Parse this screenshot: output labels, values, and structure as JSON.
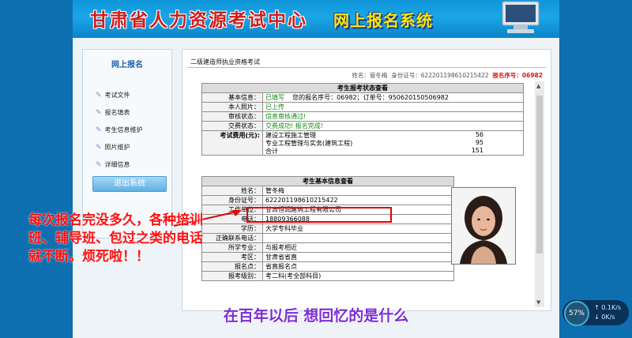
{
  "banner": {
    "title": "甘肃省人力资源考试中心",
    "system": "网上报名系统"
  },
  "sidebar": {
    "title": "网上报名",
    "items": [
      {
        "label": "考试文件"
      },
      {
        "label": "报名填表"
      },
      {
        "label": "考生信息维护"
      },
      {
        "label": "照片维护"
      },
      {
        "label": "详细信息"
      }
    ],
    "logout": "退出系统"
  },
  "exam": {
    "name": "二级建造师执业资格考试"
  },
  "candidate_line": {
    "name_label": "姓名：",
    "name": "管冬梅",
    "id_label": "身份证号：",
    "id": "622201198610215422",
    "reg_label": "报名序号：",
    "reg": "06982"
  },
  "status_section": {
    "title": "考生报考状态查看",
    "rows": [
      {
        "label": "基本信息：",
        "status": "已填写",
        "note": "您的报名序号：06982；订单号：950620150506982"
      },
      {
        "label": "本人照片：",
        "status": "已上传"
      },
      {
        "label": "审核状态：",
        "status": "信息审核通过!"
      },
      {
        "label": "交费状态：",
        "status": "交费成功! 报名完成!"
      }
    ],
    "fee_label": "考试费用(元):",
    "fees": [
      {
        "item": "建设工程施工管理",
        "amount": "56"
      },
      {
        "item": "专业工程管理与实务(建筑工程)",
        "amount": "95"
      },
      {
        "item": "合计",
        "amount": "151"
      }
    ]
  },
  "basic_section": {
    "title": "考生基本信息查看",
    "rows": [
      {
        "label": "姓名：",
        "value": "管冬梅"
      },
      {
        "label": "身份证号：",
        "value": "622201198610215422"
      },
      {
        "label": "工作单位：",
        "value": "甘肃恒润建筑工程有限公司"
      },
      {
        "label": "电话：",
        "value": "18809366088"
      },
      {
        "label": "学历：",
        "value": "大学专科毕业"
      },
      {
        "label": "正确联系电话：",
        "value": ""
      },
      {
        "label": "所学专业：",
        "value": "与报考相近"
      },
      {
        "label": "考区：",
        "value": "甘肃省省直"
      },
      {
        "label": "报名点：",
        "value": "省直报名点"
      },
      {
        "label": "报考级别：",
        "value": "考二科(考全部科目)"
      }
    ]
  },
  "annotation": "每次报名完没多久，各种培训班、辅导班、包过之类的电话就不断。烦死啦！！",
  "subtitle": "在百年以后 想回忆的是什么",
  "speed_widget": {
    "percent": "57%",
    "up": "0.1K/s",
    "down": "0K/s"
  },
  "colors": {
    "accent_blue": "#0d6fb0",
    "alert_red": "#d11c1c",
    "ok_green": "#138a13",
    "subtitle_purple": "#7a2cd6"
  }
}
